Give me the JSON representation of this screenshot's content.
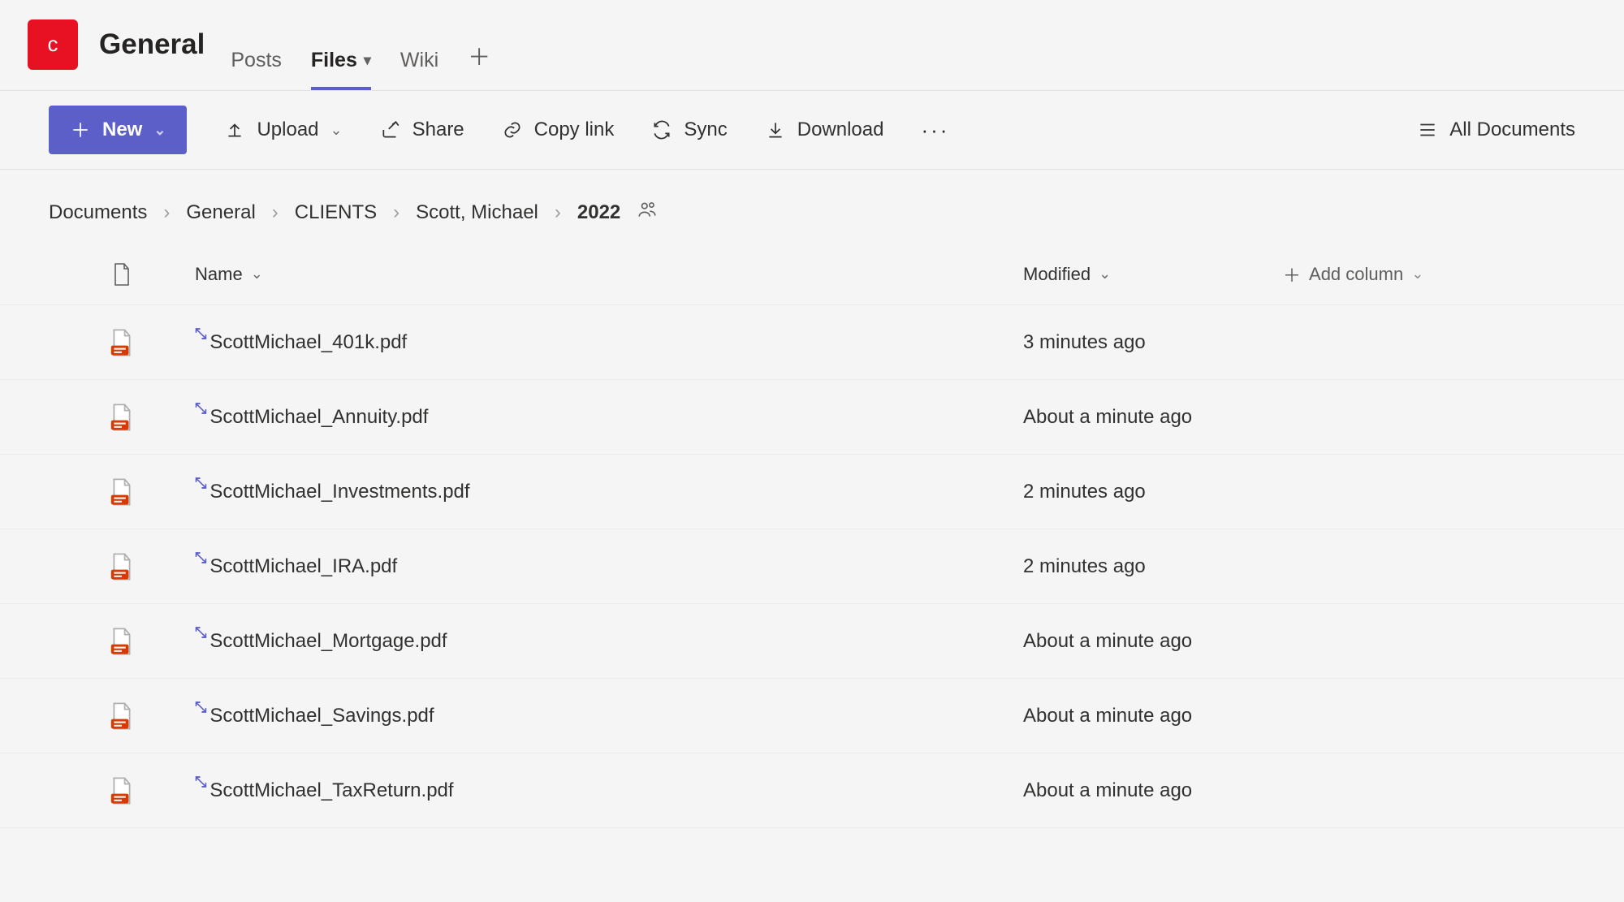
{
  "header": {
    "team_initial": "c",
    "channel_name": "General",
    "tabs": [
      {
        "label": "Posts",
        "active": false
      },
      {
        "label": "Files",
        "active": true
      },
      {
        "label": "Wiki",
        "active": false
      }
    ]
  },
  "toolbar": {
    "new_label": "New",
    "upload_label": "Upload",
    "share_label": "Share",
    "copylink_label": "Copy link",
    "sync_label": "Sync",
    "download_label": "Download",
    "view_label": "All Documents"
  },
  "breadcrumbs": [
    {
      "label": "Documents"
    },
    {
      "label": "General"
    },
    {
      "label": "CLIENTS"
    },
    {
      "label": "Scott, Michael"
    },
    {
      "label": "2022",
      "current": true
    }
  ],
  "columns": {
    "name": "Name",
    "modified": "Modified",
    "add": "Add column"
  },
  "files": [
    {
      "name": "ScottMichael_401k.pdf",
      "modified": "3 minutes ago"
    },
    {
      "name": "ScottMichael_Annuity.pdf",
      "modified": "About a minute ago"
    },
    {
      "name": "ScottMichael_Investments.pdf",
      "modified": "2 minutes ago"
    },
    {
      "name": "ScottMichael_IRA.pdf",
      "modified": "2 minutes ago"
    },
    {
      "name": "ScottMichael_Mortgage.pdf",
      "modified": "About a minute ago"
    },
    {
      "name": "ScottMichael_Savings.pdf",
      "modified": "About a minute ago"
    },
    {
      "name": "ScottMichael_TaxReturn.pdf",
      "modified": "About a minute ago"
    }
  ]
}
